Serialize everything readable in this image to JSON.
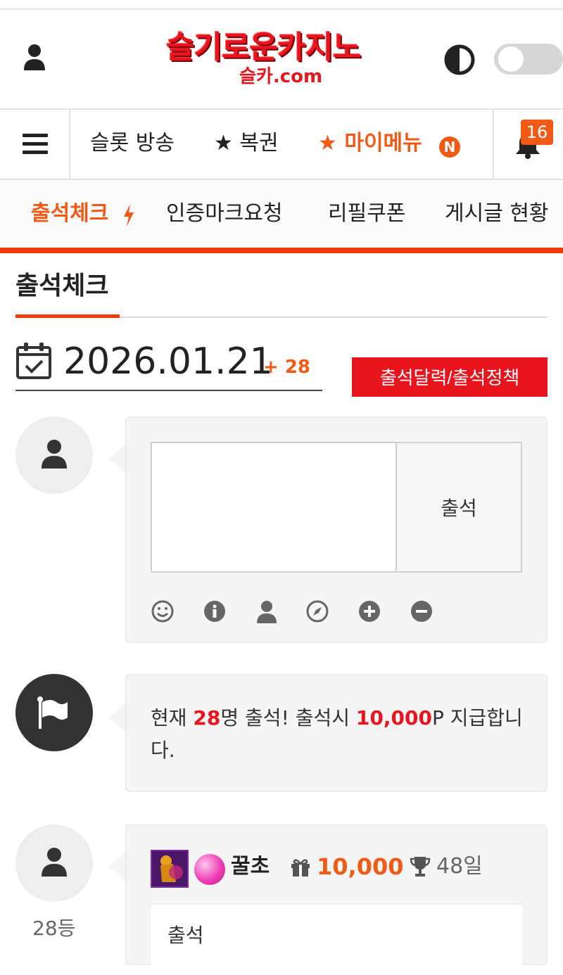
{
  "header": {
    "logo_main": "슬기로운카지노",
    "logo_sub": "슬카.com"
  },
  "nav": {
    "items": [
      "슬롯 방송",
      "★ 복권",
      "★ 마이메뉴"
    ],
    "new_badge": "N",
    "notification_count": "16"
  },
  "subnav": {
    "items": [
      "출석체크",
      "인증마크요청",
      "리필쿠폰",
      "게시글 현황"
    ]
  },
  "section": {
    "title": "출석체크"
  },
  "attendance": {
    "date": "2026.01.21",
    "plus": "+ 28",
    "policy_button": "출석달력/출석정책",
    "submit_label": "출석",
    "info_prefix": "현재 ",
    "info_count": "28",
    "info_mid": "명 출석! 출석시 ",
    "info_points": "10,000",
    "info_suffix": "P 지급합니다."
  },
  "entry": {
    "rank": "28등",
    "nickname": "꿀초",
    "points": "10,000",
    "days": "48일",
    "comment": "출석"
  },
  "colors": {
    "accent_orange": "#f05a14",
    "accent_red": "#e8141e"
  },
  "icons": [
    "user-icon",
    "contrast-icon",
    "menu-icon",
    "bell-icon",
    "bolt-icon",
    "calendar-check-icon",
    "smile-icon",
    "info-icon",
    "compass-icon",
    "plus-circle-icon",
    "minus-circle-icon",
    "flag-icon",
    "gift-icon",
    "trophy-icon"
  ]
}
